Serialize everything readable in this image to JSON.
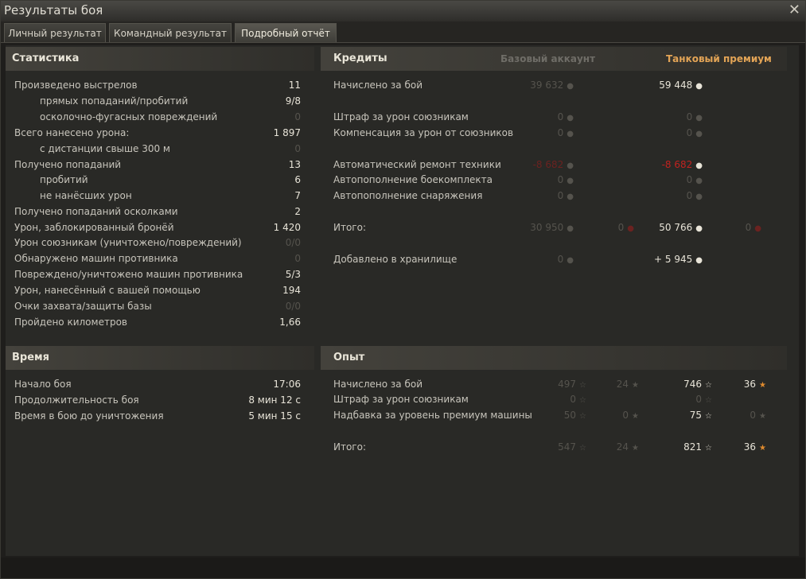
{
  "window": {
    "title": "Результаты боя",
    "close": "✕"
  },
  "tabs": [
    {
      "label": "Личный результат"
    },
    {
      "label": "Командный результат"
    },
    {
      "label": "Подробный отчёт"
    }
  ],
  "stats": {
    "title": "Статистика",
    "rows": [
      {
        "label": "Произведено выстрелов",
        "value": "11"
      },
      {
        "label": "прямых попаданий/пробитий",
        "value": "9/8"
      },
      {
        "label": "осколочно-фугасных повреждений",
        "value": "0"
      },
      {
        "label": "Всего нанесено урона:",
        "value": "1 897"
      },
      {
        "label": "с дистанции свыше 300 м",
        "value": "0"
      },
      {
        "label": "Получено попаданий",
        "value": "13"
      },
      {
        "label": "пробитий",
        "value": "6"
      },
      {
        "label": "не нанёсших урон",
        "value": "7"
      },
      {
        "label": "Получено попаданий осколками",
        "value": "2"
      },
      {
        "label": "Урон, заблокированный бронёй",
        "value": "1 420"
      },
      {
        "label": "Урон союзникам (уничтожено/повреждений)",
        "value": "0/0"
      },
      {
        "label": "Обнаружено машин противника",
        "value": "0"
      },
      {
        "label": "Повреждено/уничтожено машин противника",
        "value": "5/3"
      },
      {
        "label": "Урон, нанесённый с вашей помощью",
        "value": "194"
      },
      {
        "label": "Очки захвата/защиты базы",
        "value": "0/0"
      },
      {
        "label": "Пройдено километров",
        "value": "1,66"
      }
    ]
  },
  "time": {
    "title": "Время",
    "rows": [
      {
        "label": "Начало боя",
        "value": "17:06"
      },
      {
        "label": "Продолжительность боя",
        "value": "8 мин 12 с"
      },
      {
        "label": "Время в бою до уничтожения",
        "value": "5 мин 15 с"
      }
    ]
  },
  "credits": {
    "title": "Кредиты",
    "col_base": "Базовый аккаунт",
    "col_premium": "Танковый премиум",
    "rows": [
      {
        "label": "Начислено за бой",
        "base": "39 632",
        "premium": "59 448"
      },
      {
        "label": "Штраф за урон союзникам",
        "base": "0",
        "premium": "0"
      },
      {
        "label": "Компенсация за урон от союзников",
        "base": "0",
        "premium": "0"
      },
      {
        "label": "Автоматический ремонт техники",
        "base": "-8 682",
        "premium": "-8 682"
      },
      {
        "label": "Автопополнение боекомплекта",
        "base": "0",
        "premium": "0"
      },
      {
        "label": "Автопополнение снаряжения",
        "base": "0",
        "premium": "0"
      },
      {
        "label": "Итого:",
        "base": "30 950",
        "base_gold": "0",
        "premium": "50 766",
        "premium_gold": "0"
      },
      {
        "label": "Добавлено в хранилище",
        "base": "0",
        "premium": "+ 5 945"
      }
    ]
  },
  "xp": {
    "title": "Опыт",
    "rows": [
      {
        "label": "Начислено за бой",
        "base": "497",
        "base_free": "24",
        "premium": "746",
        "premium_free": "36"
      },
      {
        "label": "Штраф за урон союзникам",
        "base": "0",
        "premium": "0"
      },
      {
        "label": "Надбавка за уровень премиум машины",
        "base": "50",
        "base_free": "0",
        "premium": "75",
        "premium_free": "0"
      },
      {
        "label": "Итого:",
        "base": "547",
        "base_free": "24",
        "premium": "821",
        "premium_free": "36"
      }
    ]
  },
  "icons": {
    "credit": "credits-icon",
    "gold": "gold-icon",
    "xp": "xp-star-icon",
    "free_xp": "free-xp-star-icon"
  },
  "colors": {
    "premium_header": "#e3a456",
    "negative": "#c0221f"
  }
}
